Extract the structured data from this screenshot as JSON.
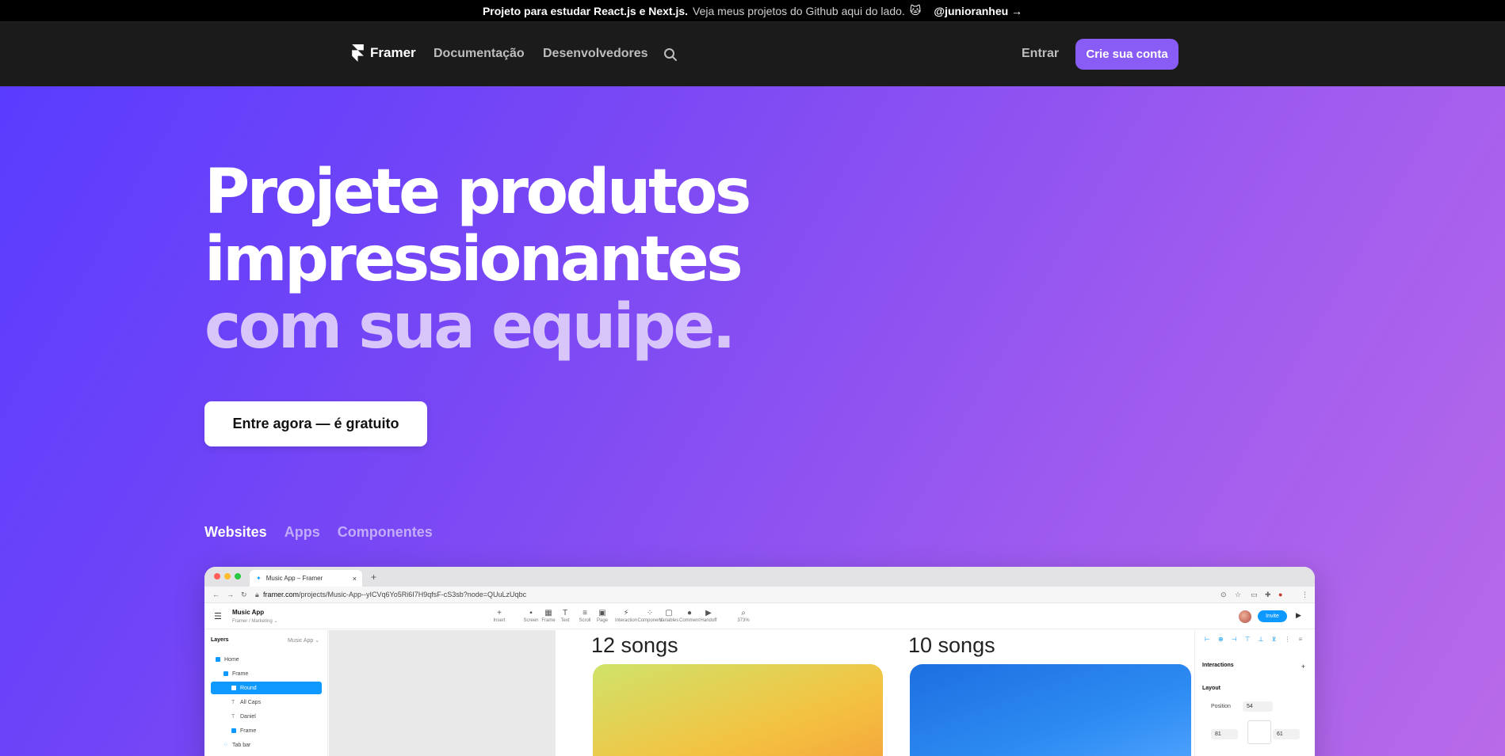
{
  "announcement": {
    "strong": "Projeto para estudar React.js e Next.js.",
    "muted": "Veja meus projetos do Github aqui do lado.",
    "emoji": "🐱",
    "handle": "@junioranheu →"
  },
  "nav": {
    "brand": "Framer",
    "links": [
      "Documentação",
      "Desenvolvedores"
    ],
    "login": "Entrar",
    "cta": "Crie sua conta"
  },
  "hero": {
    "line1": "Projete produtos",
    "line2": "impressionantes",
    "line3": "com sua equipe.",
    "button": "Entre agora — é gratuito",
    "tabs": [
      "Websites",
      "Apps",
      "Componentes"
    ]
  },
  "browser": {
    "tab_title": "Music App – Framer",
    "tab_close": "×",
    "new_tab": "+",
    "url_domain": "framer.com",
    "url_path": "/projects/Music-App--yICVq6Yo5Ri6I7H9qfsF-cS3sb?node=QUuLzUqbc",
    "project_name": "Music App",
    "project_sub": "Framer / Marketing ⌄",
    "tools": [
      {
        "icon": "+",
        "label": "Insert"
      },
      {
        "icon": "▪",
        "label": "Screen"
      },
      {
        "icon": "▦",
        "label": "Frame"
      },
      {
        "icon": "T",
        "label": "Text"
      },
      {
        "icon": "≡",
        "label": "Scroll"
      },
      {
        "icon": "▣",
        "label": "Page"
      },
      {
        "icon": "⚡",
        "label": "Interaction"
      },
      {
        "icon": "⁘",
        "label": "Component"
      },
      {
        "icon": "▢",
        "label": "Variables"
      },
      {
        "icon": "●",
        "label": "Comment"
      },
      {
        "icon": "▶",
        "label": "Handoff"
      },
      {
        "icon": "⌕",
        "label": "373%"
      }
    ],
    "invite": "Invite",
    "layers_title": "Layers",
    "layers_page": "Music App ⌄",
    "layers": [
      {
        "label": "Home",
        "depth": 0,
        "type": "frame",
        "selected": false
      },
      {
        "label": "Frame",
        "depth": 1,
        "type": "frame",
        "selected": false
      },
      {
        "label": "Round",
        "depth": 2,
        "type": "frame",
        "selected": true
      },
      {
        "label": "All Caps",
        "depth": 2,
        "type": "text",
        "selected": false
      },
      {
        "label": "Daniel",
        "depth": 2,
        "type": "text",
        "selected": false
      },
      {
        "label": "Frame",
        "depth": 2,
        "type": "frame",
        "selected": false
      },
      {
        "label": "Tab bar",
        "depth": 1,
        "type": "grid",
        "selected": false
      }
    ],
    "songs": [
      "12 songs",
      "10 songs"
    ],
    "panel": {
      "interactions": "Interactions",
      "layout": "Layout",
      "position": "Position",
      "pos_value": "54",
      "left_value": "81",
      "right_value": "61"
    }
  }
}
